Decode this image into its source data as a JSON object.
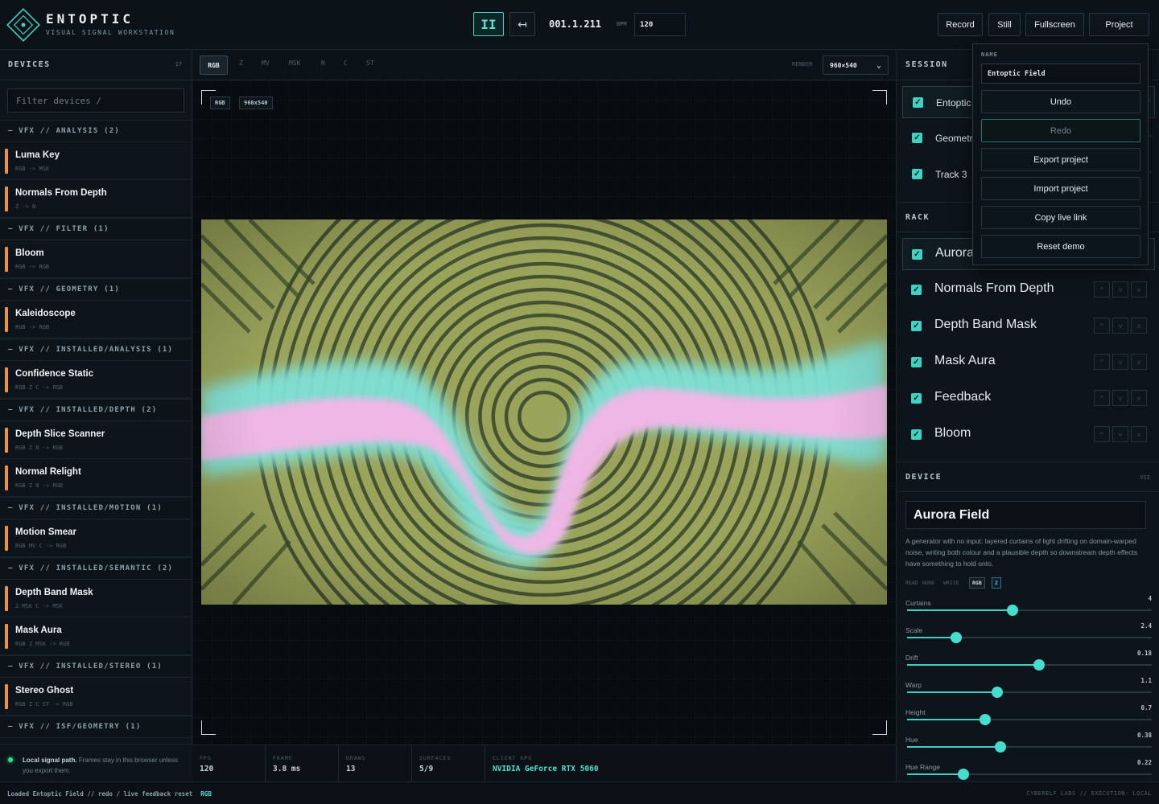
{
  "header": {
    "brand": "ENTOPTIC",
    "subtitle": "VISUAL SIGNAL WORKSTATION",
    "play_label": "II",
    "loop_label": "↤",
    "timecode": "001.1.211",
    "bpm_label": "BPM",
    "bpm_value": "120",
    "buttons": {
      "record": "Record",
      "still": "Still",
      "fullscreen": "Fullscreen",
      "project": "Project"
    },
    "accent": "#3fd1c1"
  },
  "devices": {
    "title": "DEVICES",
    "count": "17",
    "filter_placeholder": "Filter devices /",
    "groups": [
      {
        "label": "– VFX // ANALYSIS (2)",
        "items": [
          {
            "name": "Luma Key",
            "io": "RGB -> MSK"
          },
          {
            "name": "Normals From Depth",
            "io": "Z -> N"
          }
        ]
      },
      {
        "label": "– VFX // FILTER (1)",
        "items": [
          {
            "name": "Bloom",
            "io": "RGB -> RGB"
          }
        ]
      },
      {
        "label": "– VFX // GEOMETRY (1)",
        "items": [
          {
            "name": "Kaleidoscope",
            "io": "RGB -> RGB"
          }
        ]
      },
      {
        "label": "– VFX // INSTALLED/ANALYSIS (1)",
        "items": [
          {
            "name": "Confidence Static",
            "io": "RGB Z C -> RGB"
          }
        ]
      },
      {
        "label": "– VFX // INSTALLED/DEPTH (2)",
        "items": [
          {
            "name": "Depth Slice Scanner",
            "io": "RGB Z N -> RGB"
          },
          {
            "name": "Normal Relight",
            "io": "RGB Z N -> RGB"
          }
        ]
      },
      {
        "label": "– VFX // INSTALLED/MOTION (1)",
        "items": [
          {
            "name": "Motion Smear",
            "io": "RGB MV C -> RGB"
          }
        ]
      },
      {
        "label": "– VFX // INSTALLED/SEMANTIC (2)",
        "items": [
          {
            "name": "Depth Band Mask",
            "io": "Z MSK C -> MSK"
          },
          {
            "name": "Mask Aura",
            "io": "RGB Z MSK -> RGB"
          }
        ]
      },
      {
        "label": "– VFX // INSTALLED/STEREO (1)",
        "items": [
          {
            "name": "Stereo Ghost",
            "io": "RGB Z C ST -> RGB"
          }
        ]
      },
      {
        "label": "– VFX // ISF/GEOMETRY (1)",
        "items": []
      }
    ],
    "accent": "#f0923a",
    "notice_title": "Local signal path.",
    "notice_text": "Frames stay in this browser unless you export them."
  },
  "viewer": {
    "tabs": [
      "RGB",
      "Z",
      "MV",
      "MSK",
      "N",
      "C",
      "ST"
    ],
    "active_tab": "RGB",
    "render_label": "RENDER",
    "render_value": "960×540",
    "chip_channel": "RGB",
    "chip_size": "960x540",
    "stats": [
      {
        "key": "FPS",
        "value": "120"
      },
      {
        "key": "FRAME",
        "value": "3.8 ms"
      },
      {
        "key": "DRAWS",
        "value": "13"
      },
      {
        "key": "SURFACES",
        "value": "5/9"
      },
      {
        "key": "CLIENT GPU",
        "value": "NVIDIA GeForce RTX 5060"
      }
    ]
  },
  "session": {
    "title": "SESSION",
    "tracks": [
      {
        "label": "Entoptic",
        "checked": true
      },
      {
        "label": "Geometry",
        "checked": true
      },
      {
        "label": "Track 3",
        "checked": true
      }
    ]
  },
  "rack": {
    "title": "RACK",
    "items": [
      {
        "label": "Aurora",
        "checked": true
      },
      {
        "label": "Normals From Depth",
        "checked": true
      },
      {
        "label": "Depth Band Mask",
        "checked": true
      },
      {
        "label": "Mask Aura",
        "checked": true
      },
      {
        "label": "Feedback",
        "checked": true
      },
      {
        "label": "Bloom",
        "checked": true
      }
    ],
    "btn_up": "^",
    "btn_down": "v",
    "btn_remove": "x"
  },
  "device": {
    "title": "DEVICE",
    "tag": "VSI",
    "name": "Aurora Field",
    "description": "A generator with no input: layered curtains of light drifting on domain-warped noise, writing both colour and a plausible depth so downstream depth effects have something to hold onto.",
    "read_label": "READ",
    "read_value": "NONE",
    "write_label": "WRITE",
    "write_channels": [
      "RGB",
      "Z"
    ],
    "params": [
      {
        "label": "Curtains",
        "value": "4",
        "fraction": 0.43
      },
      {
        "label": "Scale",
        "value": "2.4",
        "fraction": 0.2
      },
      {
        "label": "Drift",
        "value": "0.18",
        "fraction": 0.54
      },
      {
        "label": "Warp",
        "value": "1.1",
        "fraction": 0.37
      },
      {
        "label": "Height",
        "value": "0.7",
        "fraction": 0.32
      },
      {
        "label": "Hue",
        "value": "0.38",
        "fraction": 0.38
      },
      {
        "label": "Hue Range",
        "value": "0.22",
        "fraction": 0.23
      }
    ]
  },
  "project_menu": {
    "name_label": "NAME",
    "name_value": "Entoptic Field",
    "undo": "Undo",
    "redo": "Redo",
    "export": "Export project",
    "import": "Import project",
    "copy_link": "Copy live link",
    "reset": "Reset demo"
  },
  "footer": {
    "status": "Loaded Entoptic Field // redo / live feedback reset",
    "channel": "RGB",
    "right": "CYBERELF LABS // EXECUTION: LOCAL"
  }
}
